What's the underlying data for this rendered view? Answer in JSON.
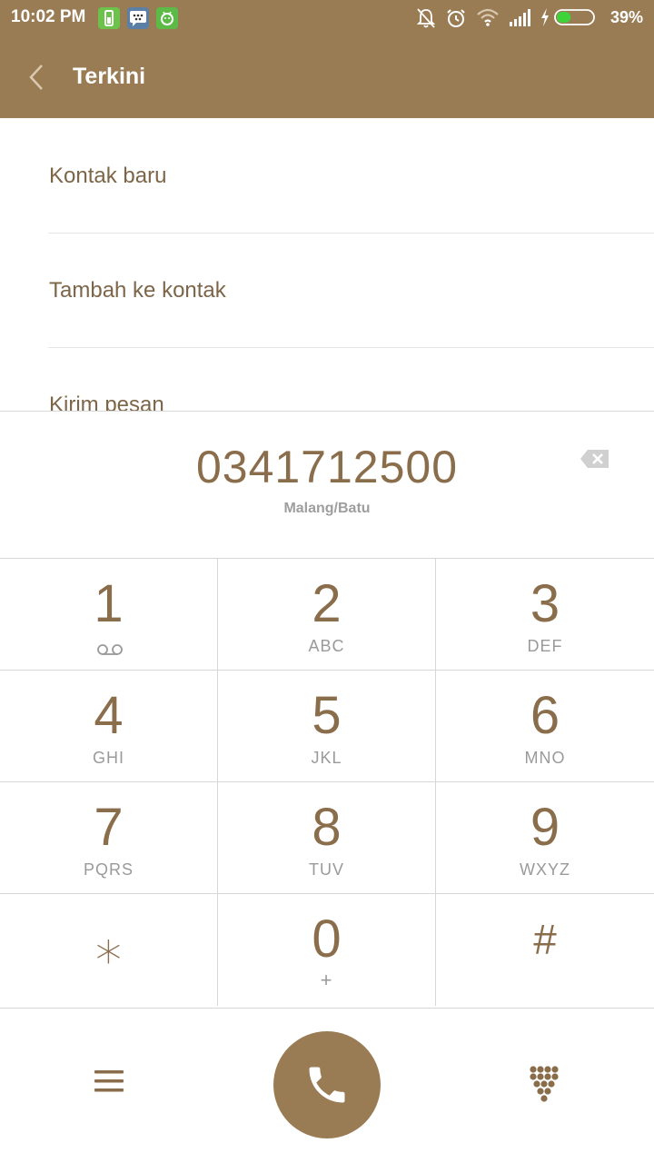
{
  "status_bar": {
    "time": "10:02 PM",
    "battery_percent": "39%",
    "icons": [
      "battery-app-icon",
      "bbm-icon",
      "android-icon",
      "mute-icon",
      "alarm-icon",
      "wifi-icon",
      "signal-icon",
      "charging-icon",
      "battery-icon"
    ],
    "battery_level": 0.39,
    "battery_color": "#3fd33a"
  },
  "app_bar": {
    "title": "Terkini",
    "back_icon": "chevron-left-icon",
    "color": "#9a7c54"
  },
  "options": [
    {
      "label": "Kontak baru"
    },
    {
      "label": "Tambah ke kontak"
    },
    {
      "label": "Kirim pesan"
    }
  ],
  "display": {
    "number": "0341712500",
    "location": "Malang/Batu",
    "backspace_icon": "backspace-icon"
  },
  "keypad": {
    "keys": [
      {
        "digit": "1",
        "sub": "",
        "sub_icon": "voicemail-icon"
      },
      {
        "digit": "2",
        "sub": "ABC"
      },
      {
        "digit": "3",
        "sub": "DEF"
      },
      {
        "digit": "4",
        "sub": "GHI"
      },
      {
        "digit": "5",
        "sub": "JKL"
      },
      {
        "digit": "6",
        "sub": "MNO"
      },
      {
        "digit": "7",
        "sub": "PQRS"
      },
      {
        "digit": "8",
        "sub": "TUV"
      },
      {
        "digit": "9",
        "sub": "WXYZ"
      },
      {
        "digit": "⁎",
        "sub": ""
      },
      {
        "digit": "0",
        "sub": "+"
      },
      {
        "digit": "#",
        "sub": ""
      }
    ]
  },
  "bottom_bar": {
    "left_icon": "menu-icon",
    "center_icon": "phone-icon",
    "right_icon": "dialpad-icon",
    "accent": "#9a7c54"
  }
}
